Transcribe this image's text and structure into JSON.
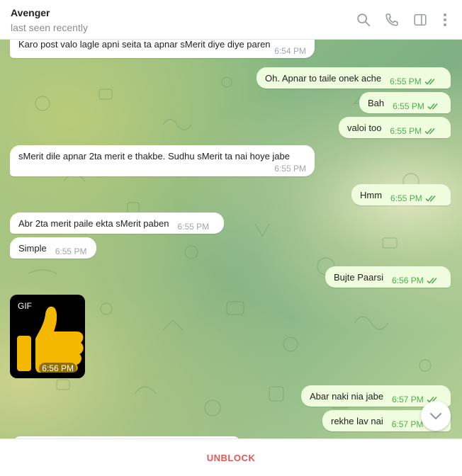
{
  "header": {
    "title": "Avenger",
    "status": "last seen recently",
    "icons": [
      "search-icon",
      "phone-icon",
      "sidebar-toggle-icon",
      "more-vertical-icon"
    ]
  },
  "messages": [
    {
      "dir": "in",
      "text": "Karo post valo lagle apni seita ta apnar sMerit diye diye paren",
      "time": "6:54 PM"
    },
    {
      "dir": "out",
      "text": "Oh. Apnar to taile onek ache",
      "time": "6:55 PM",
      "read": true
    },
    {
      "dir": "out",
      "text": "Bah",
      "time": "6:55 PM",
      "read": true
    },
    {
      "dir": "out",
      "text": "valoi too",
      "time": "6:55 PM",
      "read": true
    },
    {
      "dir": "in",
      "text": "sMerit dile apnar 2ta merit e thakbe. Sudhu sMerit ta nai hoye jabe",
      "time": "6:55 PM"
    },
    {
      "dir": "out",
      "text": "Hmm",
      "time": "6:55 PM",
      "read": true
    },
    {
      "dir": "in",
      "text": "Abr 2ta merit paile ekta sMerit paben",
      "time": "6:55 PM"
    },
    {
      "dir": "in",
      "text": "Simple",
      "time": "6:55 PM"
    },
    {
      "dir": "out",
      "text": "Bujte Paarsi",
      "time": "6:56 PM",
      "read": true
    },
    {
      "dir": "out",
      "text": "Abar naki nia jabe",
      "time": "6:57 PM",
      "read": true
    },
    {
      "dir": "out",
      "text": "rekhe lav nai",
      "time": "6:57 PM",
      "read": true
    }
  ],
  "gif": {
    "badge": "GIF",
    "time": "6:56 PM"
  },
  "footer": {
    "unblock_label": "UNBLOCK"
  },
  "colors": {
    "incoming": "#ffffff",
    "outgoing": "#effdde",
    "accent": "#4fae4e",
    "unblock": "#e05757"
  }
}
